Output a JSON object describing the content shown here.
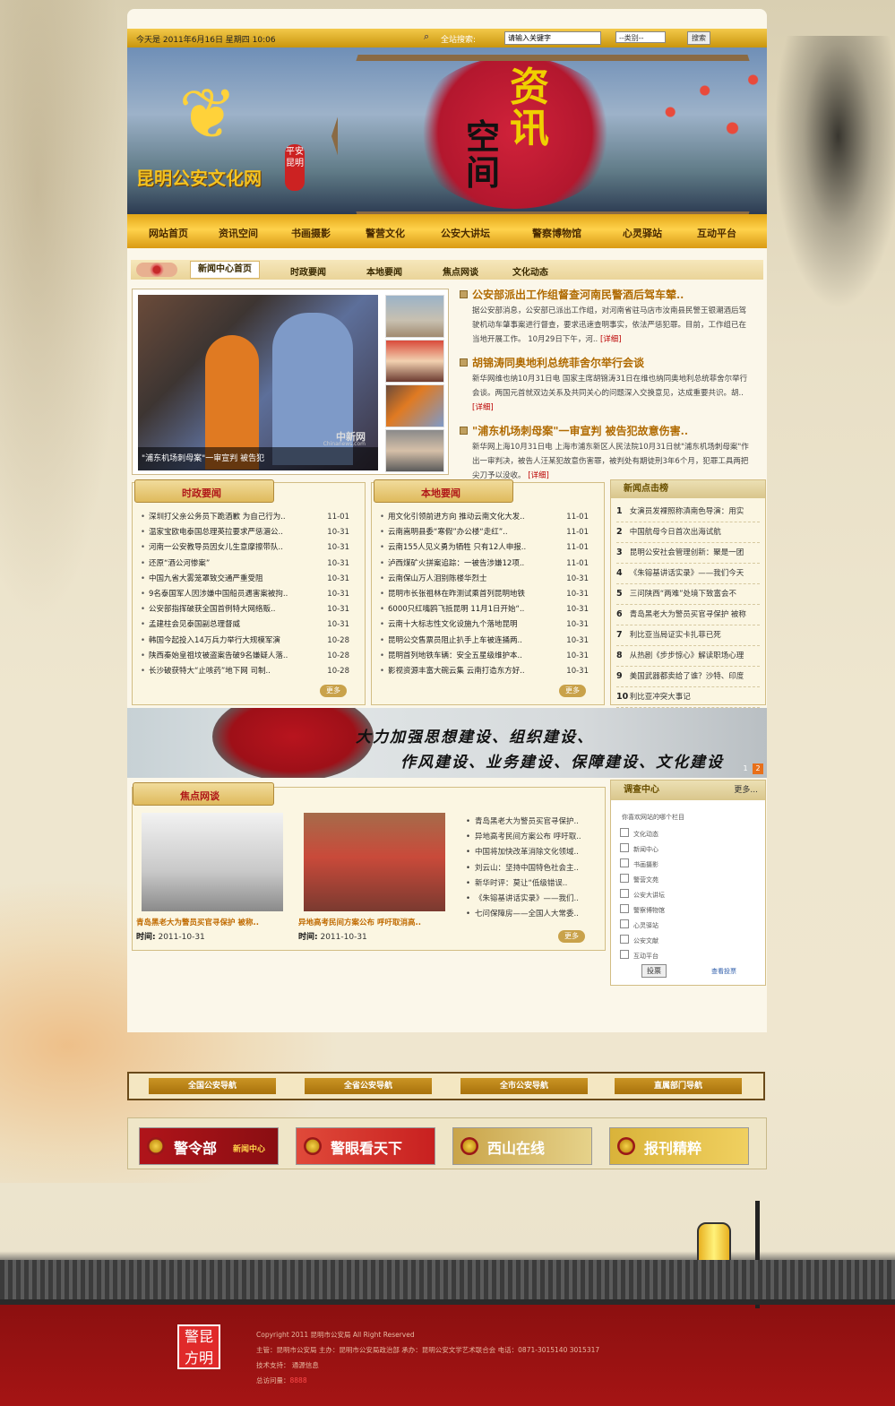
{
  "topbar": {
    "date_text": "今天是 2011年6月16日  星期四  10:06",
    "search_label": "全站搜索:",
    "search_placeholder": "请输入关键字",
    "category_select": "--类别--",
    "search_button": "搜索"
  },
  "banner": {
    "site_name": "昆明公安文化网",
    "seal_text": "平安昆明",
    "headline_char_1": "资讯",
    "headline_char_2": "空间",
    "icons": {
      "laurel": "laurel-emblem-icon",
      "seal": "seal-icon"
    }
  },
  "nav": [
    "网站首页",
    "资讯空间",
    "书画摄影",
    "警营文化",
    "公安大讲坛",
    "警察博物馆",
    "心灵驿站",
    "互动平台"
  ],
  "news_tabs": [
    "新闻中心首页",
    "时政要闻",
    "本地要闻",
    "焦点网谈",
    "文化动态"
  ],
  "featured": {
    "main_caption": "\"浦东机场刺母案\"一审宣判 被告犯",
    "watermark": "中新网",
    "watermark_url": "Chinanews.com",
    "articles": [
      {
        "title": "公安部派出工作组督查河南民警酒后驾车辇..",
        "body": "据公安部消息，公安部已派出工作组，对河南省驻马店市汝南县民警王银潮酒后驾驶机动车肇事案进行督查，要求迅速查明事实，依法严惩犯罪。目前，工作组已在当地开展工作。 10月29日下午，河..",
        "more": "[详细]"
      },
      {
        "title": "胡锦涛同奥地利总统菲舍尔举行会谈",
        "body": "新华网维也纳10月31日电 国家主席胡锦涛31日在维也纳同奥地利总统菲舍尔举行会谈。两国元首就双边关系及共同关心的问题深入交换意见，达成重要共识。胡..",
        "more": "[详细]"
      },
      {
        "title": "\"浦东机场刺母案\"一审宣判 被告犯故意伤害..",
        "body": "新华网上海10月31日电 上海市浦东新区人民法院10月31日就\"浦东机场刺母案\"作出一审判决，被告人汪某犯故意伤害罪，被判处有期徒刑3年6个月，犯罪工具两把尖刀予以没收。",
        "more": "[详细]"
      }
    ]
  },
  "politics": {
    "title": "时政要闻",
    "more": "更多",
    "items": [
      {
        "t": "深圳打父亲公务员下跪酒歉 为自己行为..",
        "d": "11-01"
      },
      {
        "t": "温家宝欧电泰国总理英拉要求严惩湄公..",
        "d": "10-31"
      },
      {
        "t": "河南一公安教导员因女儿生意摩擦带队..",
        "d": "10-31"
      },
      {
        "t": "还原“酒公河惨案”",
        "d": "10-31"
      },
      {
        "t": "中国九省大雾笼罩致交通严重受阻",
        "d": "10-31"
      },
      {
        "t": "9名泰国军人因涉嫌中国船员遇害案被拘..",
        "d": "10-31"
      },
      {
        "t": "公安部指挥破获全国首例特大网络贩..",
        "d": "10-31"
      },
      {
        "t": "孟建柱会见泰国副总理督威",
        "d": "10-31"
      },
      {
        "t": "韩国今起投入14万兵力举行大规模军演",
        "d": "10-28"
      },
      {
        "t": "陕西秦始皇祖坟被盗案告破9名嫌疑人落..",
        "d": "10-28"
      },
      {
        "t": "长沙破获特大“止咳药”地下网 司制..",
        "d": "10-28"
      }
    ]
  },
  "local": {
    "title": "本地要闻",
    "more": "更多",
    "items": [
      {
        "t": "用文化引领前进方向 推动云南文化大发..",
        "d": "11-01"
      },
      {
        "t": "云南嵩明县委“寒假”办公楼“走红”..",
        "d": "11-01"
      },
      {
        "t": "云南155人见义勇为牺牲 只有12人申报..",
        "d": "11-01"
      },
      {
        "t": "泸西煤矿火拼案追踪：一被告涉嫌12项..",
        "d": "11-01"
      },
      {
        "t": "云南保山万人泪别陈楼华烈士",
        "d": "10-31"
      },
      {
        "t": "昆明市长张祖林在昨测试乘首列昆明地铁",
        "d": "10-31"
      },
      {
        "t": "6000只红嘴鸥飞抵昆明 11月1日开始“..",
        "d": "10-31"
      },
      {
        "t": "云南十大标志性文化设施九个落地昆明",
        "d": "10-31"
      },
      {
        "t": "昆明公交售票员阻止扒手上车被连捅两..",
        "d": "10-31"
      },
      {
        "t": "昆明首列地铁车辆：安全五星级维护本..",
        "d": "10-31"
      },
      {
        "t": "影视资源丰富大碗云集 云南打造东方好..",
        "d": "10-31"
      }
    ]
  },
  "hot": {
    "title": "新闻点击榜",
    "items": [
      {
        "n": "1",
        "t": "女演员发裸照称滇南色导演：用实"
      },
      {
        "n": "2",
        "t": "中国航母今日首次出海试航"
      },
      {
        "n": "3",
        "t": "昆明公安社会管理创新：聚是一团"
      },
      {
        "n": "4",
        "t": "《朱镕基讲话实录》——我们今天"
      },
      {
        "n": "5",
        "t": "三问陕西“两难”处境下致富会不"
      },
      {
        "n": "6",
        "t": "青岛黑老大为警员买官寻保护 被称"
      },
      {
        "n": "7",
        "t": "利比亚当局证实卡扎菲已死"
      },
      {
        "n": "8",
        "t": "从热剧《步步惊心》解读职场心理"
      },
      {
        "n": "9",
        "t": "美国武器都卖给了谁？沙特、印度"
      },
      {
        "n": "10",
        "t": "利比亚冲突大事记"
      }
    ]
  },
  "slogan": {
    "line1": "大力加强思想建设、组织建设、",
    "line2": "作风建设、业务建设、保障建设、文化建设",
    "page1": "1",
    "page2": "2"
  },
  "focus": {
    "title": "焦点网谈",
    "more": "更多",
    "time_label": "时间:",
    "cards": [
      {
        "caption": "青岛黑老大为警员买官寻保护 被称..",
        "time": "2011-10-31"
      },
      {
        "caption": "异地高考民间方案公布 呼吁取消高..",
        "time": "2011-10-31"
      }
    ],
    "items": [
      "青岛黑老大为警员买官寻保护..",
      "异地高考民间方案公布 呼吁取..",
      "中国将加快改革消除文化领域..",
      "刘云山：坚持中国特色社会主..",
      "新华时评：莫让“低级错误..",
      "《朱镕基讲话实录》——我们..",
      "七问保障房——全国人大常委.."
    ]
  },
  "survey": {
    "title": "调查中心",
    "more": "更多...",
    "question": "你喜欢网站的哪个栏目",
    "options": [
      "文化动态",
      "新闻中心",
      "书画摄影",
      "警营文苑",
      "公安大讲坛",
      "警察博物馆",
      "心灵驿站",
      "公安文献",
      "互动平台"
    ],
    "vote": "投票",
    "view": "查看投票"
  },
  "police_nav": [
    "全国公安导航",
    "全省公安导航",
    "全市公安导航",
    "直属部门导航"
  ],
  "link_ads": [
    {
      "label": "警令部",
      "sub": "新闻中心",
      "color": "#b0141a"
    },
    {
      "label": "警眼看天下",
      "sub": "",
      "color": "#d8352b"
    },
    {
      "label": "西山在线",
      "sub": "",
      "color": "#c9a449"
    },
    {
      "label": "报刊精粹",
      "sub": "",
      "color": "#d9b33a"
    }
  ],
  "footer": {
    "logo": "警昆方明",
    "copyright": "Copyright 2011 昆明市公安局 All Right Reserved",
    "line2": "主管：昆明市公安局    主办：昆明市公安局政治部    承办：昆明公安文学艺术联合会    电话：0871-3015140 3015317",
    "line3": "技术支持：  通源信息",
    "visits_label": "总访问量：",
    "visits": "8888"
  }
}
